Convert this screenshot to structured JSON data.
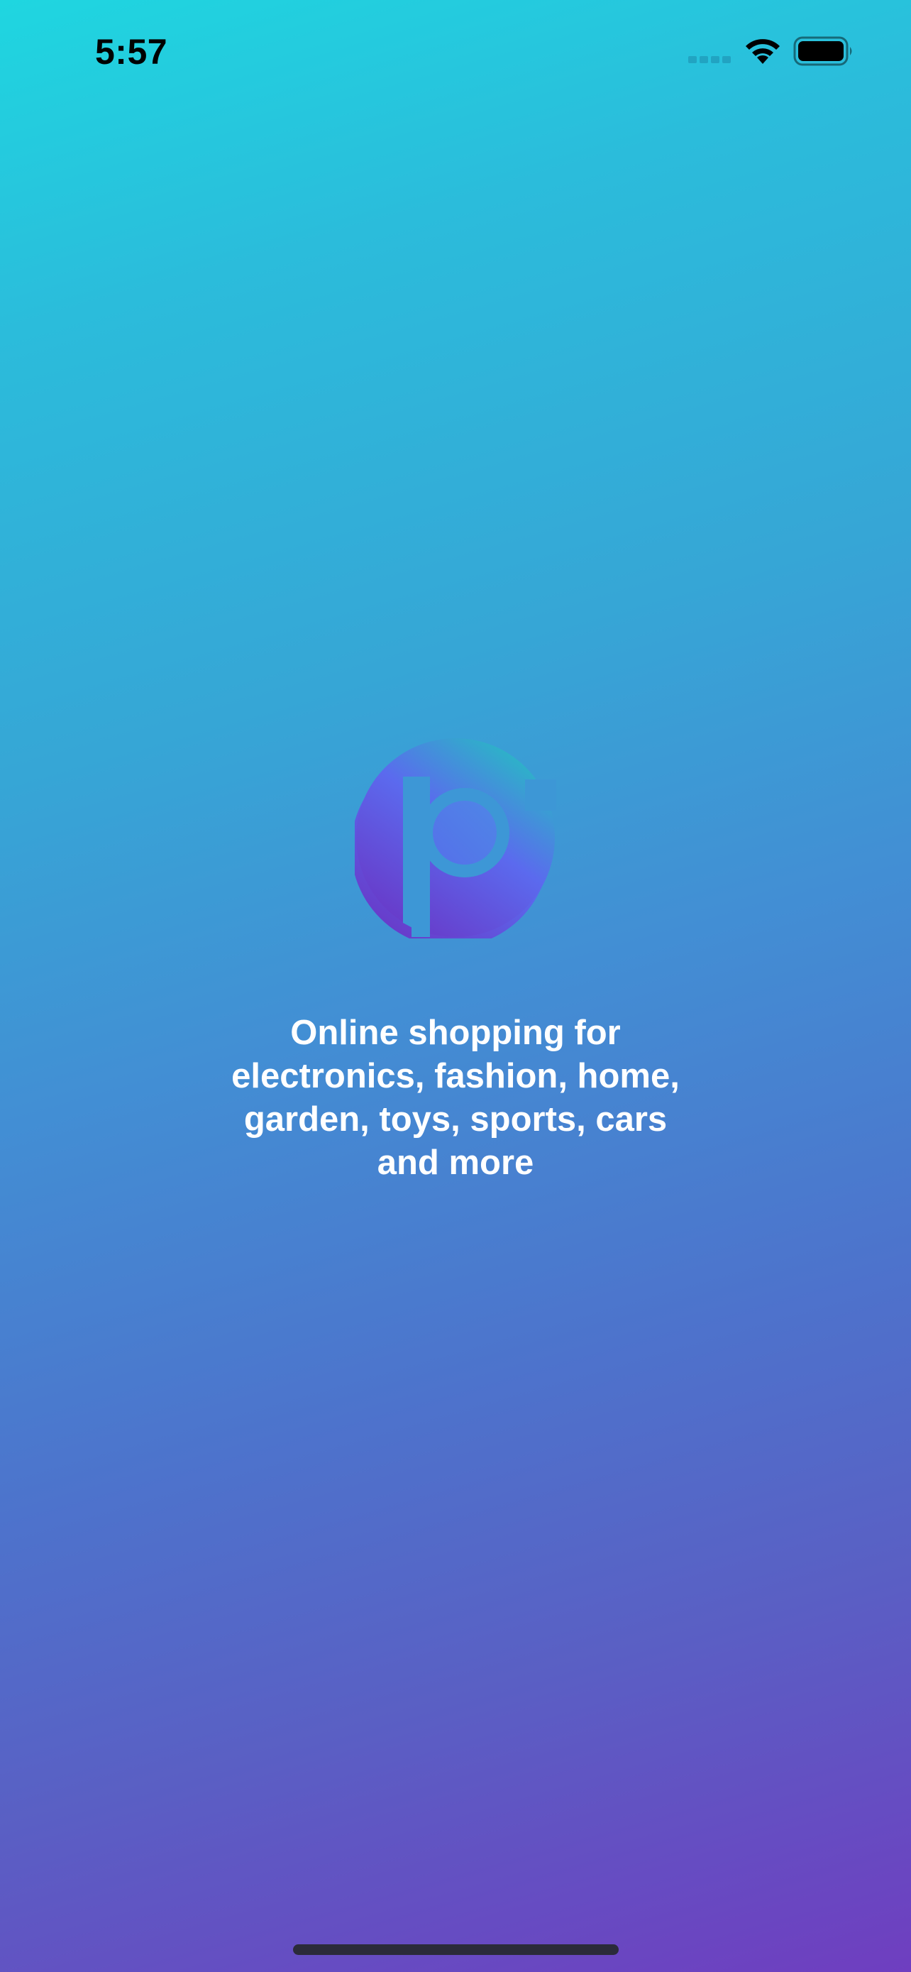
{
  "status_bar": {
    "time": "5:57",
    "icons": [
      "signal-dots-icon",
      "wifi-icon",
      "battery-icon"
    ]
  },
  "splash": {
    "logo": "p-logo",
    "tagline": "Online shopping for\nelectronics, fashion, home,\ngarden, toys, sports, cars\nand more"
  },
  "colors": {
    "gradient_top": "#1fd6e0",
    "gradient_middle": "#428fd4",
    "gradient_bottom": "#6f3ec0",
    "tagline_text": "#ffffff",
    "status_text": "#000000"
  }
}
